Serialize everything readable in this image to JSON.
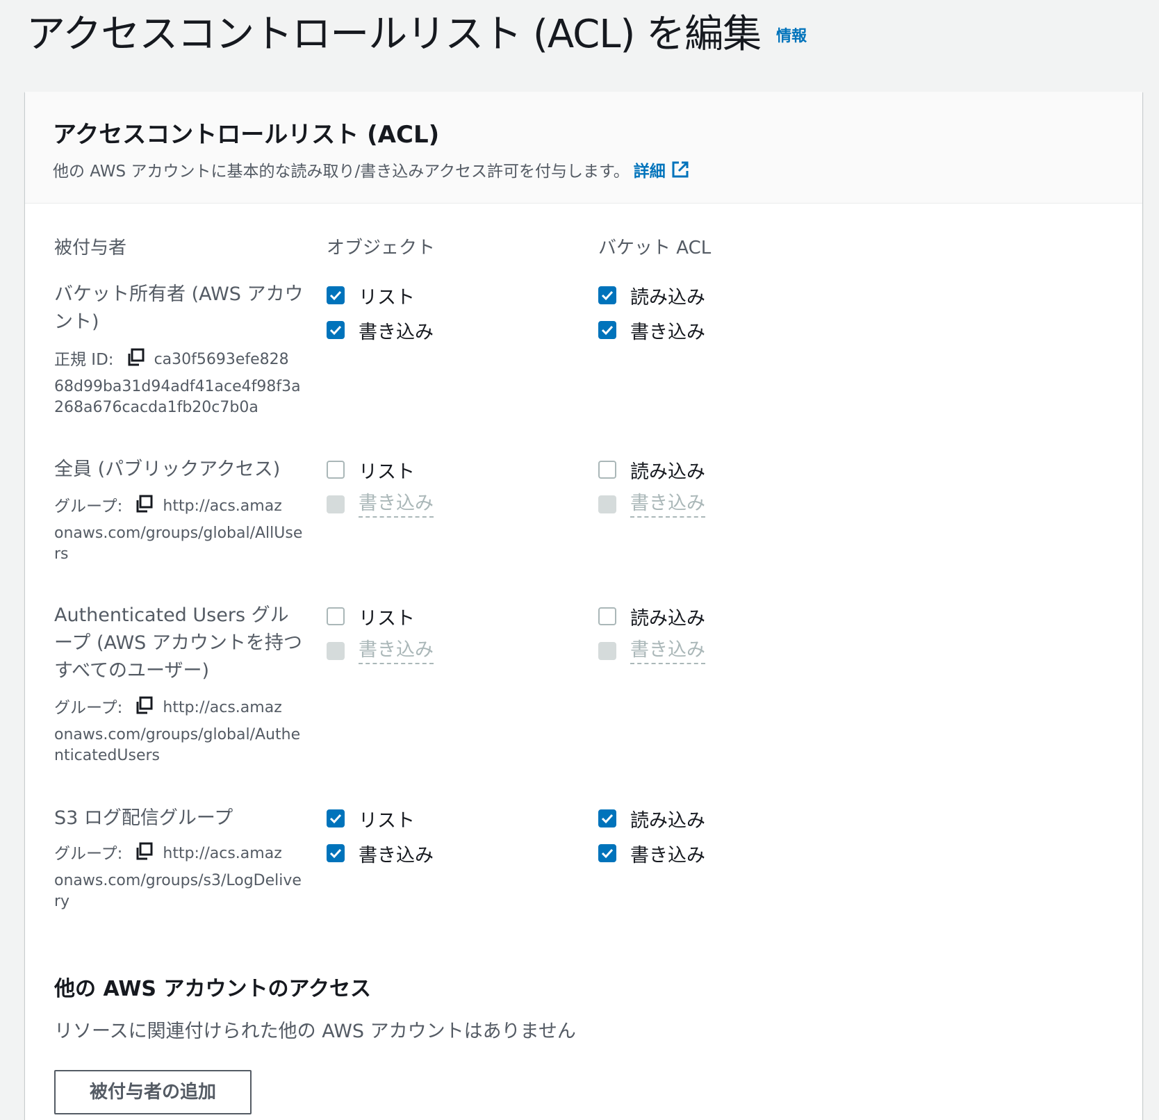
{
  "page": {
    "title": "アクセスコントロールリスト (ACL) を編集",
    "info_link": "情報"
  },
  "acl": {
    "title": "アクセスコントロールリスト (ACL)",
    "description": "他の AWS アカウントに基本的な読み取り/書き込みアクセス許可を付与します。",
    "learn_more": "詳細",
    "columns": {
      "grantee": "被付与者",
      "objects": "オブジェクト",
      "bucket_acl": "バケット ACL"
    },
    "grantees": [
      {
        "name": "バケット所有者 (AWS アカウント)",
        "id_label": "正規 ID:",
        "id_value_first": "ca30f5693efe828",
        "id_value_rest": "68d99ba31d94adf41ace4f98f3a268a676cacda1fb20c7b0a",
        "objects": {
          "list": {
            "label": "リスト",
            "checked": true,
            "disabled": false
          },
          "write": {
            "label": "書き込み",
            "checked": true,
            "disabled": false
          }
        },
        "bucket_acl": {
          "read": {
            "label": "読み込み",
            "checked": true,
            "disabled": false
          },
          "write": {
            "label": "書き込み",
            "checked": true,
            "disabled": false
          }
        }
      },
      {
        "name": "全員 (パブリックアクセス)",
        "id_label": "グループ:",
        "id_value_first": "http://acs.amaz",
        "id_value_rest": "onaws.com/groups/global/AllUsers",
        "objects": {
          "list": {
            "label": "リスト",
            "checked": false,
            "disabled": false
          },
          "write": {
            "label": "書き込み",
            "checked": false,
            "disabled": true
          }
        },
        "bucket_acl": {
          "read": {
            "label": "読み込み",
            "checked": false,
            "disabled": false
          },
          "write": {
            "label": "書き込み",
            "checked": false,
            "disabled": true
          }
        }
      },
      {
        "name": "Authenticated Users グループ (AWS アカウントを持つすべてのユーザー)",
        "id_label": "グループ:",
        "id_value_first": "http://acs.amaz",
        "id_value_rest": "onaws.com/groups/global/AuthenticatedUsers",
        "objects": {
          "list": {
            "label": "リスト",
            "checked": false,
            "disabled": false
          },
          "write": {
            "label": "書き込み",
            "checked": false,
            "disabled": true
          }
        },
        "bucket_acl": {
          "read": {
            "label": "読み込み",
            "checked": false,
            "disabled": false
          },
          "write": {
            "label": "書き込み",
            "checked": false,
            "disabled": true
          }
        }
      },
      {
        "name": "S3 ログ配信グループ",
        "id_label": "グループ:",
        "id_value_first": "http://acs.amaz",
        "id_value_rest": "onaws.com/groups/s3/LogDelivery",
        "objects": {
          "list": {
            "label": "リスト",
            "checked": true,
            "disabled": false
          },
          "write": {
            "label": "書き込み",
            "checked": true,
            "disabled": false
          }
        },
        "bucket_acl": {
          "read": {
            "label": "読み込み",
            "checked": true,
            "disabled": false
          },
          "write": {
            "label": "書き込み",
            "checked": true,
            "disabled": false
          }
        }
      }
    ]
  },
  "other_accounts": {
    "title": "他の AWS アカウントのアクセス",
    "empty_text": "リソースに関連付けられた他の AWS アカウントはありません",
    "add_button": "被付与者の追加"
  },
  "colors": {
    "link": "#0073bb",
    "checkbox_checked": "#0073bb",
    "checkbox_disabled": "#d5dbdb",
    "page_background": "#f2f3f3",
    "text_secondary": "#545b64"
  },
  "icons": {
    "copy": "copy-icon",
    "external_link": "external-link-icon",
    "check": "check-icon"
  }
}
